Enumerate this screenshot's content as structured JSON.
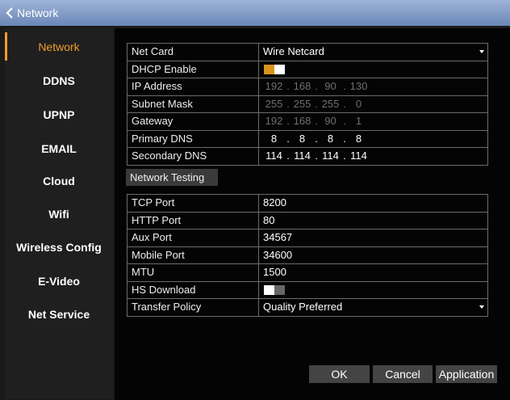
{
  "window": {
    "title": "Network"
  },
  "sidebar": {
    "items": [
      {
        "label": "Network"
      },
      {
        "label": "DDNS"
      },
      {
        "label": "UPNP"
      },
      {
        "label": "EMAIL"
      },
      {
        "label": "Cloud"
      },
      {
        "label": "Wifi"
      },
      {
        "label": "Wireless Config"
      },
      {
        "label": "E-Video"
      },
      {
        "label": "Net Service"
      }
    ]
  },
  "net": {
    "net_card_label": "Net Card",
    "net_card_value": "Wire Netcard",
    "dhcp_label": "DHCP Enable",
    "dhcp_enabled": true,
    "ip_label": "IP Address",
    "ip": [
      "192",
      "168",
      "90",
      "130"
    ],
    "subnet_label": "Subnet Mask",
    "subnet": [
      "255",
      "255",
      "255",
      "0"
    ],
    "gateway_label": "Gateway",
    "gateway": [
      "192",
      "168",
      "90",
      "1"
    ],
    "pdns_label": "Primary DNS",
    "pdns": [
      "8",
      "8",
      "8",
      "8"
    ],
    "sdns_label": "Secondary DNS",
    "sdns": [
      "114",
      "114",
      "114",
      "114"
    ]
  },
  "network_testing_label": "Network Testing",
  "ports": {
    "tcp_label": "TCP Port",
    "tcp_value": "8200",
    "http_label": "HTTP Port",
    "http_value": "80",
    "aux_label": "Aux Port",
    "aux_value": "34567",
    "mobile_label": "Mobile Port",
    "mobile_value": "34600",
    "mtu_label": "MTU",
    "mtu_value": "1500",
    "hs_label": "HS Download",
    "hs_enabled": false,
    "transfer_label": "Transfer Policy",
    "transfer_value": "Quality Preferred"
  },
  "buttons": {
    "ok": "OK",
    "cancel": "Cancel",
    "apply": "Application"
  },
  "colors": {
    "accent": "#f29b2c",
    "titlebar": "#7f9ac6"
  }
}
